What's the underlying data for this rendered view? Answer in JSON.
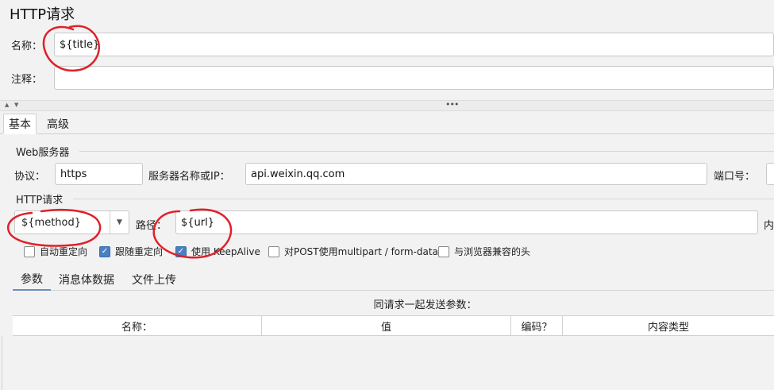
{
  "header": {
    "title": "HTTP请求"
  },
  "name_field": {
    "label": "名称：",
    "value": "${title}"
  },
  "comment_field": {
    "label": "注释：",
    "value": ""
  },
  "tabs": [
    {
      "label": "基本"
    },
    {
      "label": "高级"
    }
  ],
  "web_server": {
    "section_label": "Web服务器",
    "protocol_label": "协议：",
    "protocol_value": "https",
    "server_label": "服务器名称或IP：",
    "server_value": "api.weixin.qq.com",
    "port_label": "端口号："
  },
  "http_request": {
    "section_label": "HTTP请求",
    "method_value": "${method}",
    "path_label": "路径：",
    "path_value": "${url}",
    "content_label_partial": "内"
  },
  "checkboxes": [
    {
      "label": "自动重定向",
      "checked": false
    },
    {
      "label": "跟随重定向",
      "checked": true
    },
    {
      "label": "使用 KeepAlive",
      "checked": true
    },
    {
      "label": "对POST使用multipart / form-data",
      "checked": false
    },
    {
      "label": "与浏览器兼容的头",
      "checked": false
    }
  ],
  "sub_tabs": [
    {
      "label": "参数"
    },
    {
      "label": "消息体数据"
    },
    {
      "label": "文件上传"
    }
  ],
  "params": {
    "caption": "同请求一起发送参数：",
    "columns": [
      "名称：",
      "值",
      "编码？",
      "内容类型"
    ]
  },
  "annotation_color": "#e0202a"
}
